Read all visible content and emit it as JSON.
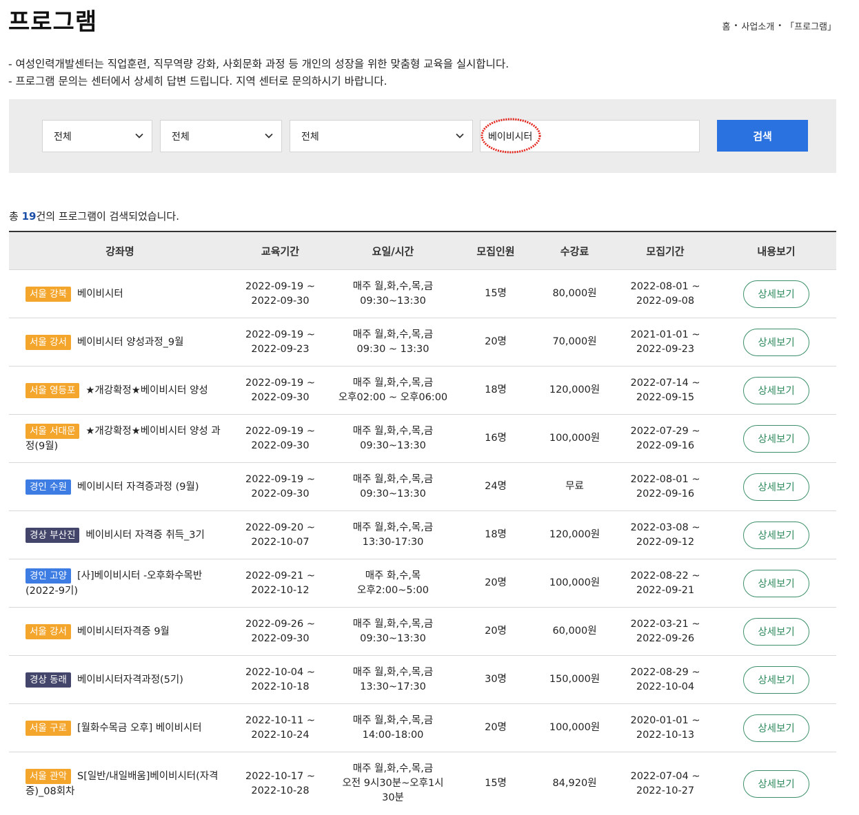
{
  "page": {
    "title": "프로그램",
    "breadcrumb": [
      "홈",
      "사업소개",
      "「프로그램」"
    ],
    "intro": [
      "- 여성인력개발센터는 직업훈련, 직무역량 강화, 사회문화 과정 등 개인의 성장을 위한 맞춤형 교육을 실시합니다.",
      "- 프로그램 문의는 센터에서 상세히 답변 드립니다. 지역 센터로 문의하시기 바랍니다."
    ]
  },
  "search": {
    "select1": "전체",
    "select2": "전체",
    "select3": "전체",
    "keyword": "베이비시터",
    "button": "검색",
    "mark_color": "#e3251b"
  },
  "result": {
    "prefix": "총 ",
    "count": "19",
    "suffix": "건의 프로그램이 검색되었습니다."
  },
  "table": {
    "headers": [
      "강좌명",
      "교육기간",
      "요일/시간",
      "모집인원",
      "수강료",
      "모집기간",
      "내용보기"
    ],
    "rows": [
      {
        "badge": "서울 강북",
        "badge_type": "orange",
        "name": "베이비시터",
        "period": [
          "2022-09-19 ~",
          "2022-09-30"
        ],
        "time": [
          "매주 월,화,수,목,금",
          "09:30~13:30"
        ],
        "capacity": "15명",
        "fee": "80,000원",
        "recruit": [
          "2022-08-01 ~",
          "2022-09-08"
        ],
        "button": "상세보기"
      },
      {
        "badge": "서울 강서",
        "badge_type": "orange",
        "name": "베이비시터 양성과정_9월",
        "period": [
          "2022-09-19 ~",
          "2022-09-23"
        ],
        "time": [
          "매주 월,화,수,목,금",
          "09:30 ~ 13:30"
        ],
        "capacity": "20명",
        "fee": "70,000원",
        "recruit": [
          "2021-01-01 ~",
          "2022-09-23"
        ],
        "button": "상세보기"
      },
      {
        "badge": "서울 영등포",
        "badge_type": "orange",
        "name": "★개강확정★베이비시터 양성",
        "period": [
          "2022-09-19 ~",
          "2022-09-30"
        ],
        "time": [
          "매주 월,화,수,목,금",
          "오후02:00 ~ 오후06:00"
        ],
        "capacity": "18명",
        "fee": "120,000원",
        "recruit": [
          "2022-07-14 ~",
          "2022-09-15"
        ],
        "button": "상세보기"
      },
      {
        "badge": "서울 서대문",
        "badge_type": "orange",
        "name": "★개강확정★베이비시터 양성 과정(9월)",
        "period": [
          "2022-09-19 ~",
          "2022-09-30"
        ],
        "time": [
          "매주 월,화,수,목,금",
          "09:30~13:30"
        ],
        "capacity": "16명",
        "fee": "100,000원",
        "recruit": [
          "2022-07-29 ~",
          "2022-09-16"
        ],
        "button": "상세보기"
      },
      {
        "badge": "경인 수원",
        "badge_type": "blue",
        "name": "베이비시터 자격증과정 (9월)",
        "period": [
          "2022-09-19 ~",
          "2022-09-30"
        ],
        "time": [
          "매주 월,화,수,목,금",
          "09:30~13:30"
        ],
        "capacity": "24명",
        "fee": "무료",
        "recruit": [
          "2022-08-01 ~",
          "2022-09-16"
        ],
        "button": "상세보기"
      },
      {
        "badge": "경상 부산진",
        "badge_type": "navy",
        "name": "베이비시터 자격증 취득_3기",
        "period": [
          "2022-09-20 ~",
          "2022-10-07"
        ],
        "time": [
          "매주 월,화,수,목,금",
          "13:30-17:30"
        ],
        "capacity": "18명",
        "fee": "120,000원",
        "recruit": [
          "2022-03-08 ~",
          "2022-09-12"
        ],
        "button": "상세보기"
      },
      {
        "badge": "경인 고양",
        "badge_type": "blue",
        "name": "[사]베이비시터 -오후화수목반 (2022-9기)",
        "period": [
          "2022-09-21 ~",
          "2022-10-12"
        ],
        "time": [
          "매주 화,수,목",
          "오후2:00~5:00"
        ],
        "capacity": "20명",
        "fee": "100,000원",
        "recruit": [
          "2022-08-22 ~",
          "2022-09-21"
        ],
        "button": "상세보기"
      },
      {
        "badge": "서울 강서",
        "badge_type": "orange",
        "name": "베이비시터자격증 9월",
        "period": [
          "2022-09-26 ~",
          "2022-09-30"
        ],
        "time": [
          "매주 월,화,수,목,금",
          "09:30~13:30"
        ],
        "capacity": "20명",
        "fee": "60,000원",
        "recruit": [
          "2022-03-21 ~",
          "2022-09-26"
        ],
        "button": "상세보기"
      },
      {
        "badge": "경상 동래",
        "badge_type": "navy",
        "name": "베이비시터자격과정(5기)",
        "period": [
          "2022-10-04 ~",
          "2022-10-18"
        ],
        "time": [
          "매주 월,화,수,목,금",
          "13:30~17:30"
        ],
        "capacity": "30명",
        "fee": "150,000원",
        "recruit": [
          "2022-08-29 ~",
          "2022-10-04"
        ],
        "button": "상세보기"
      },
      {
        "badge": "서울 구로",
        "badge_type": "orange",
        "name": "[월화수목금 오후] 베이비시터",
        "period": [
          "2022-10-11 ~",
          "2022-10-24"
        ],
        "time": [
          "매주 월,화,수,목,금",
          "14:00-18:00"
        ],
        "capacity": "20명",
        "fee": "100,000원",
        "recruit": [
          "2020-01-01 ~",
          "2022-10-13"
        ],
        "button": "상세보기"
      },
      {
        "badge": "서울 관악",
        "badge_type": "orange",
        "name": "S[일반/내일배움]베이비시터(자격증)_08회차",
        "period": [
          "2022-10-17 ~",
          "2022-10-28"
        ],
        "time": [
          "매주 월,화,수,목,금",
          "오전 9시30분~오후1시",
          "30분"
        ],
        "capacity": "15명",
        "fee": "84,920원",
        "recruit": [
          "2022-07-04 ~",
          "2022-10-27"
        ],
        "button": "상세보기"
      }
    ]
  }
}
